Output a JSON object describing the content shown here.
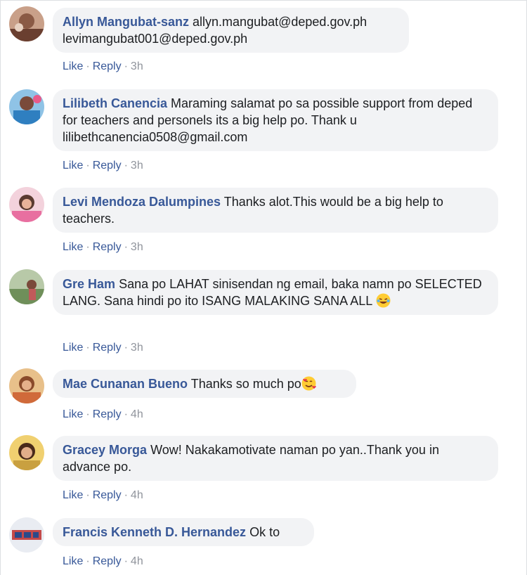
{
  "comments": [
    {
      "author": "Allyn Mangubat-sanz",
      "text": "allyn.mangubat@deped.gov.ph levimangubat001@deped.gov.ph",
      "emoji": "",
      "actions": {
        "like": "Like",
        "reply": "Reply",
        "time": "3h"
      },
      "avatar_color": "#b07a5c"
    },
    {
      "author": "Lilibeth Canencia",
      "text": "Maraming salamat po sa possible support from deped for teachers and personels its a big help po. Thank u lilibethcanencia0508@gmail.com",
      "emoji": "",
      "actions": {
        "like": "Like",
        "reply": "Reply",
        "time": "3h"
      },
      "avatar_color": "#4a90c9"
    },
    {
      "author": "Levi Mendoza Dalumpines",
      "text": "Thanks alot.This would be a big help to teachers.",
      "emoji": "",
      "actions": {
        "like": "Like",
        "reply": "Reply",
        "time": "3h"
      },
      "avatar_color": "#e59ab5"
    },
    {
      "author": "Gre Ham",
      "text": "Sana po LAHAT sinisendan ng email, baka namn po SELECTED LANG. Sana hindi po ito ISANG MALAKING SANA ALL",
      "emoji": "rolling-on-floor-laughing",
      "actions": {
        "like": "Like",
        "reply": "Reply",
        "time": "3h"
      },
      "avatar_color": "#8aa37a"
    },
    {
      "author": "Mae Cunanan Bueno",
      "text": "Thanks so much po",
      "emoji": "smiling-face-with-hearts",
      "actions": {
        "like": "Like",
        "reply": "Reply",
        "time": "4h"
      },
      "avatar_color": "#d9a066"
    },
    {
      "author": "Gracey Morga",
      "text": "Wow! Nakakamotivate naman po yan..Thank you in advance po.",
      "emoji": "",
      "actions": {
        "like": "Like",
        "reply": "Reply",
        "time": "4h"
      },
      "avatar_color": "#d9b24a"
    },
    {
      "author": "Francis Kenneth D. Hernandez",
      "text": "Ok to",
      "emoji": "",
      "actions": {
        "like": "Like",
        "reply": "Reply",
        "time": "4h"
      },
      "avatar_color": "#c44a4a"
    }
  ],
  "colors": {
    "author": "#385898",
    "bubble": "#f2f3f5",
    "text": "#1c1e21",
    "muted": "#90949c"
  }
}
